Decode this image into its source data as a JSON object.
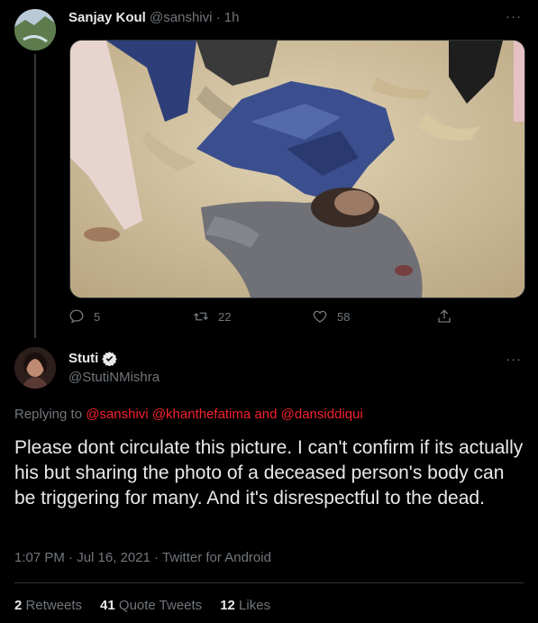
{
  "tweet1": {
    "name": "Sanjay Koul",
    "handle": "@sanshivi",
    "time": "1h",
    "replies": "5",
    "retweets": "22",
    "likes": "58"
  },
  "tweet2": {
    "name": "Stuti",
    "handle": "@StutiNMishra",
    "replying_prefix": "Replying to",
    "replying_to": [
      "@sanshivi",
      "@khanthefatima"
    ],
    "replying_and": "and",
    "replying_last": "@dansiddiqui",
    "text": "Please dont circulate this picture. I can't confirm if its actually his but sharing the photo of a deceased person's body can be triggering for many. And it's disrespectful to the dead.",
    "time": "1:07 PM",
    "date": "Jul 16, 2021",
    "source": "Twitter for Android",
    "retweets_count": "2",
    "retweets_label": "Retweets",
    "quotes_count": "41",
    "quotes_label": "Quote Tweets",
    "likes_count": "12",
    "likes_label": "Likes"
  },
  "icons": {
    "more": "more-icon",
    "reply": "reply-icon",
    "retweet": "retweet-icon",
    "like": "heart-icon",
    "share": "share-icon",
    "verified": "verified-badge-icon"
  },
  "colors": {
    "background": "#000000",
    "text": "#e7e9ea",
    "muted": "#71767b",
    "link": "#f4212e",
    "divider": "#2f3336"
  }
}
